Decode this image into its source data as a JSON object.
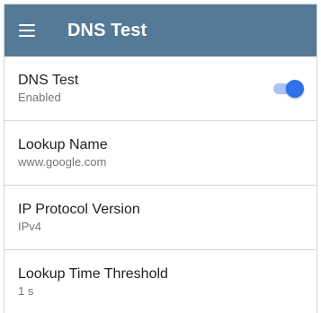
{
  "app_bar": {
    "title": "DNS Test",
    "menu_icon": "hamburger-menu-icon",
    "background_color": "#557a97"
  },
  "settings": [
    {
      "title": "DNS Test",
      "value": "Enabled",
      "toggle": true,
      "toggle_on": true
    },
    {
      "title": "Lookup Name",
      "value": "www.google.com"
    },
    {
      "title": "IP Protocol Version",
      "value": "IPv4"
    },
    {
      "title": "Lookup Time Threshold",
      "value": "1 s"
    }
  ],
  "colors": {
    "accent": "#2f6fe8",
    "title_text": "#212121",
    "secondary_text": "#757575"
  }
}
